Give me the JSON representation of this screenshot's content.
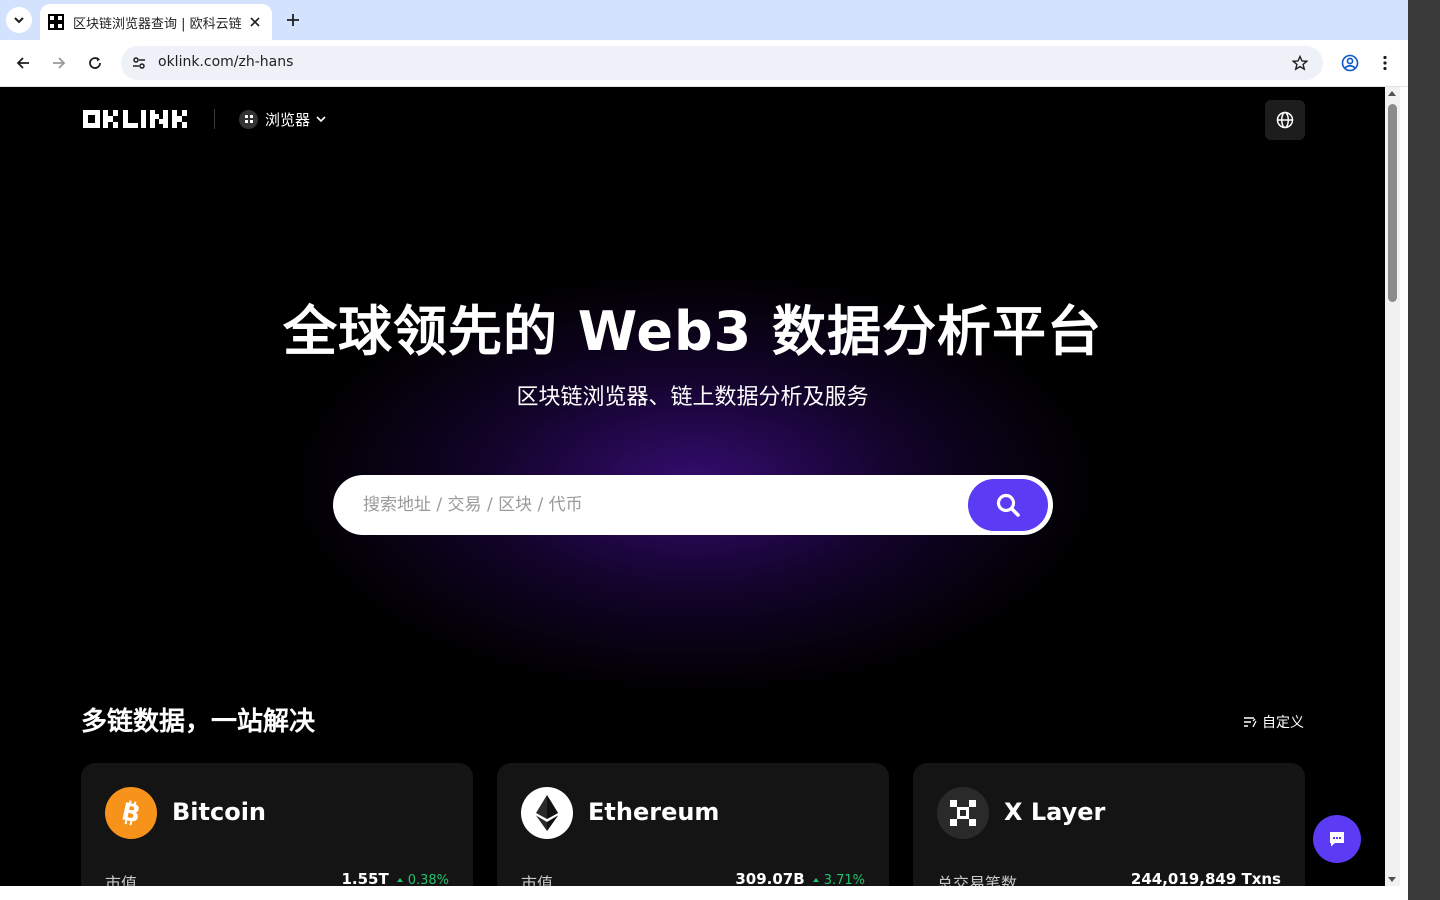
{
  "browser": {
    "tab_title": "区块链浏览器查询 | 欧科云链",
    "url": "oklink.com/zh-hans"
  },
  "header": {
    "logo_text": "OKLINK",
    "explorer_label": "浏览器"
  },
  "hero": {
    "title": "全球领先的 Web3 数据分析平台",
    "subtitle": "区块链浏览器、链上数据分析及服务",
    "search_placeholder": "搜索地址 / 交易 / 区块 / 代币"
  },
  "section": {
    "title": "多链数据，一站解决",
    "customize_label": "自定义"
  },
  "chains": [
    {
      "name": "Bitcoin",
      "metric_label": "市值",
      "metric_value": "1.55T",
      "change": "0.38%",
      "icon": "bitcoin-icon",
      "color": "#f7931a"
    },
    {
      "name": "Ethereum",
      "metric_label": "市值",
      "metric_value": "309.07B",
      "change": "3.71%",
      "icon": "ethereum-icon",
      "color": "#ffffff"
    },
    {
      "name": "X Layer",
      "metric_label": "总交易笔数",
      "metric_value": "244,019,849 Txns",
      "change": "",
      "icon": "xlayer-icon",
      "color": "#2a2a2a"
    }
  ],
  "colors": {
    "accent": "#5b3bf4",
    "positive": "#25c26e",
    "background": "#000000"
  }
}
